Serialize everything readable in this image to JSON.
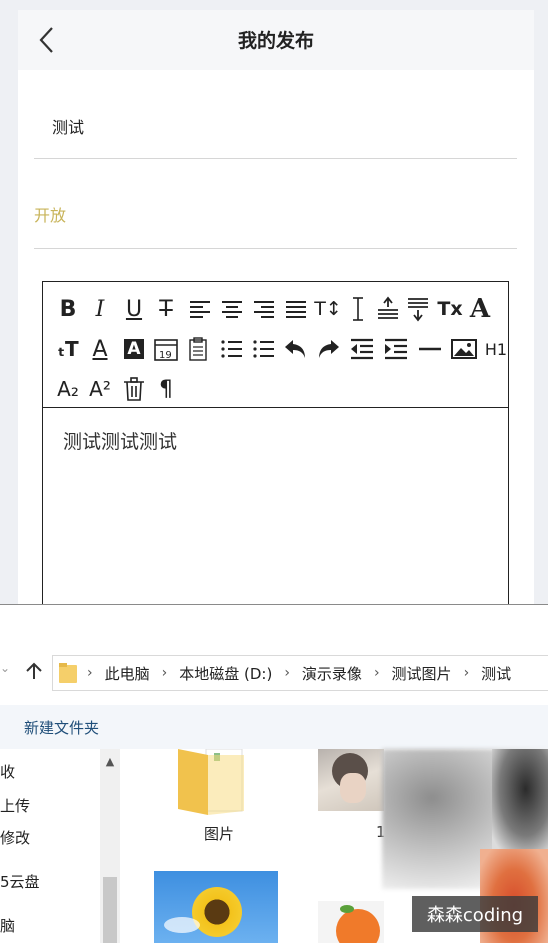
{
  "page": {
    "title": "我的发布",
    "back_icon": "chevron-left-icon",
    "post_title": "测试",
    "status_label": "开放",
    "status_color": "#c8b45a",
    "editor": {
      "content": "测试测试测试",
      "toolbar_labels": {
        "heading1": "H1"
      },
      "toolbar_icons": [
        "bold-icon",
        "italic-icon",
        "underline-icon",
        "strikethrough-icon",
        "align-left-icon",
        "align-center-icon",
        "align-right-icon",
        "align-justify-icon",
        "font-size-icon",
        "line-height-icon",
        "paragraph-spacing-top-icon",
        "paragraph-spacing-bottom-icon",
        "clear-format-icon",
        "font-icon",
        "font-scale-icon",
        "font-color-icon",
        "background-color-icon",
        "date-icon",
        "clipboard-icon",
        "ordered-list-icon",
        "unordered-list-icon",
        "undo-icon",
        "redo-icon",
        "outdent-icon",
        "indent-icon",
        "horizontal-rule-icon",
        "image-icon",
        "heading1-icon",
        "subscript-icon",
        "superscript-icon",
        "delete-icon",
        "paragraph-icon"
      ]
    }
  },
  "explorer": {
    "breadcrumbs": [
      "此电脑",
      "本地磁盘 (D:)",
      "演示录像",
      "测试图片",
      "测试"
    ],
    "toolbar": {
      "new_folder": "新建文件夹"
    },
    "nav_items": [
      "收",
      "上传",
      "修改",
      "5云盘",
      "脑"
    ],
    "files": [
      {
        "name": "图片",
        "kind": "folder"
      },
      {
        "name": "1",
        "kind": "image"
      },
      {
        "name": "",
        "kind": "image"
      },
      {
        "name": "",
        "kind": "image"
      }
    ]
  },
  "watermark": "森森coding"
}
